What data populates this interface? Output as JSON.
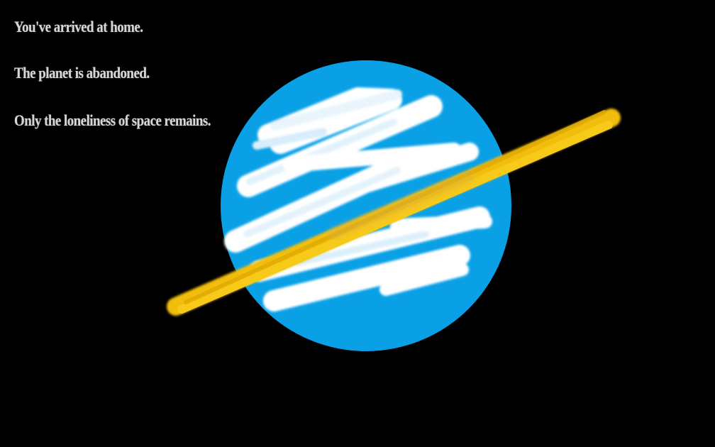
{
  "story": {
    "lines": [
      "You've arrived at home.",
      "The planet is abandoned.",
      "Only the  loneliness of space remains."
    ]
  },
  "scene": {
    "background_color": "#000000",
    "planet_color": "#0aa0e6",
    "cloud_color": "#ffffff",
    "ring_color": "#f2be0c",
    "text_color": "#d6d6d6"
  }
}
